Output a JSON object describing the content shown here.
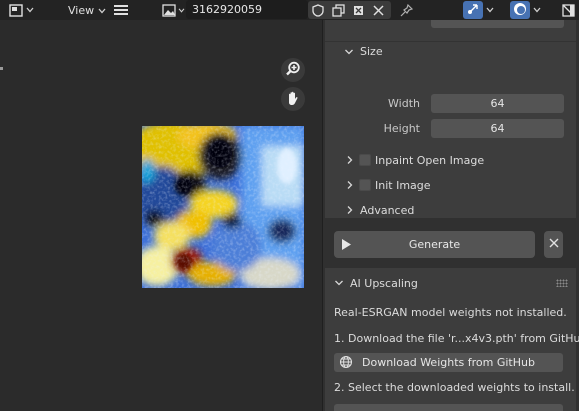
{
  "header": {
    "editor_type_icon": "image-editor-icon",
    "view_menu_label": "View",
    "menu_icon": "hamburger-menu-icon",
    "image_browse_icon": "image-browse-icon",
    "seed_value": "3162920059",
    "fake_user_icon": "shield-icon",
    "duplicate_icon": "duplicate-image-icon",
    "close_icon": "close-icon",
    "pin_icon": "pin-icon",
    "gizmo_icon": "navigation-gizmo-icon",
    "overlay_icon": "overlay-icon",
    "sidebar_toggle_icon": "sidebar-toggle-icon"
  },
  "viewport": {
    "zoom_icon": "zoom-icon",
    "hand_icon": "hand-pan-icon"
  },
  "sidebar": {
    "size_panel": {
      "title": "Size",
      "width_label": "Width",
      "width_value": "64",
      "height_label": "Height",
      "height_value": "64"
    },
    "inpaint_label": "Inpaint Open Image",
    "init_image_label": "Init Image",
    "advanced_label": "Advanced",
    "generate_label": "Generate",
    "cancel_icon": "close-icon",
    "upscaling_panel": {
      "title": "AI Upscaling",
      "message": "Real-ESRGAN model weights not installed.",
      "step1": "1. Download the file 'r...x4v3.pth' from GitHub",
      "download_label": "Download Weights from GitHub",
      "step2": "2. Select the downloaded weights to install."
    }
  },
  "colors": {
    "accent_blue": "#4772b3",
    "panel_bg": "#3d3d3d",
    "field_bg": "#545454",
    "background": "#2b2b2b"
  }
}
